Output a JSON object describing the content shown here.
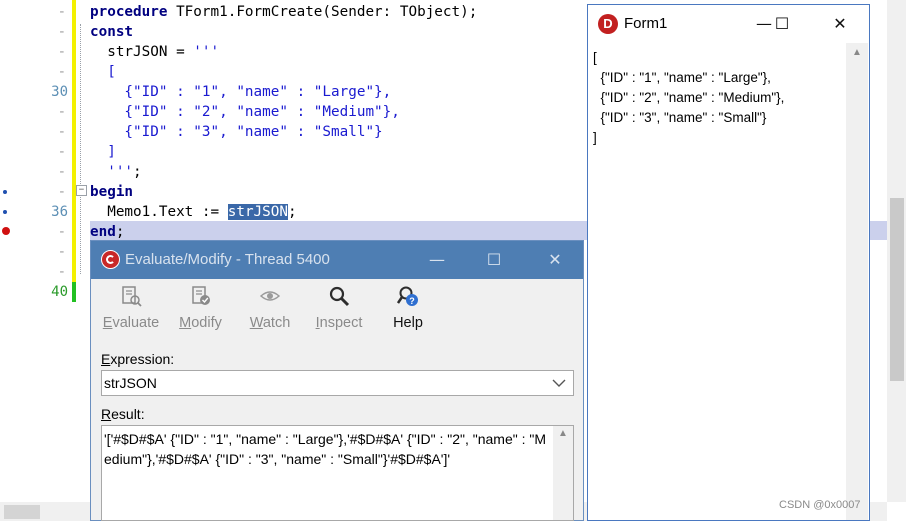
{
  "editor": {
    "gutter": [
      {
        "dash": "-",
        "num": "",
        "marker": ""
      },
      {
        "dash": "-",
        "num": "",
        "marker": ""
      },
      {
        "dash": "-",
        "num": "",
        "marker": ""
      },
      {
        "dash": "-",
        "num": "",
        "marker": ""
      },
      {
        "dash": "",
        "num": "30",
        "marker": ""
      },
      {
        "dash": "-",
        "num": "",
        "marker": ""
      },
      {
        "dash": "-",
        "num": "",
        "marker": ""
      },
      {
        "dash": "-",
        "num": "",
        "marker": ""
      },
      {
        "dash": "-",
        "num": "",
        "marker": ""
      },
      {
        "dash": "-",
        "num": "",
        "marker": "dot"
      },
      {
        "dash": "",
        "num": "36",
        "marker": "dot"
      },
      {
        "dash": "-",
        "num": "",
        "marker": "bp"
      },
      {
        "dash": "-",
        "num": "",
        "marker": ""
      },
      {
        "dash": "-",
        "num": "",
        "marker": ""
      },
      {
        "dash": "",
        "num": "40",
        "marker": ""
      }
    ],
    "code": {
      "l1_kw": "procedure",
      "l1_rest": " TForm1.FormCreate(Sender: TObject);",
      "l2_kw": "const",
      "l3_a": "  strJSON = ",
      "l3_str": "'''",
      "l4": "  [",
      "l5": "    {\"ID\" : \"1\", \"name\" : \"Large\"},",
      "l6": "    {\"ID\" : \"2\", \"name\" : \"Medium\"},",
      "l7": "    {\"ID\" : \"3\", \"name\" : \"Small\"}",
      "l8": "  ]",
      "l9_str": "  '''",
      "l9_rest": ";",
      "l10_kw": "begin",
      "l11_a": "  Memo1.Text := ",
      "l11_sel": "strJSON",
      "l11_b": ";",
      "l12_kw": "end",
      "l12_b": ";"
    }
  },
  "form1": {
    "title": "Form1",
    "logo_letter": "D",
    "btn_min": "—",
    "btn_max": "☐",
    "btn_close": "✕",
    "memo_lines": [
      "[",
      "  {\"ID\" : \"1\", \"name\" : \"Large\"},",
      "  {\"ID\" : \"2\", \"name\" : \"Medium\"},",
      "  {\"ID\" : \"3\", \"name\" : \"Small\"}",
      "]"
    ]
  },
  "eval": {
    "title": "Evaluate/Modify - Thread 5400",
    "btn_min": "—",
    "btn_max": "☐",
    "btn_close": "✕",
    "tools": {
      "evaluate": {
        "first": "E",
        "rest": "valuate"
      },
      "modify": {
        "first": "M",
        "rest": "odify"
      },
      "watch": {
        "first": "W",
        "rest": "atch"
      },
      "inspect": {
        "first": "I",
        "rest": "nspect"
      },
      "help": {
        "label": "Help"
      }
    },
    "expression_label": {
      "first": "E",
      "rest": "xpression:"
    },
    "expression_value": "strJSON",
    "result_label": {
      "first": "R",
      "rest": "esult:"
    },
    "result_value": "'['#$D#$A'  {\"ID\" : \"1\", \"name\" : \"Large\"},'#$D#$A'  {\"ID\" : \"2\", \"name\" : \"Medium\"},'#$D#$A'  {\"ID\" : \"3\", \"name\" : \"Small\"}'#$D#$A']'"
  },
  "watermark": "CSDN @0x0007"
}
